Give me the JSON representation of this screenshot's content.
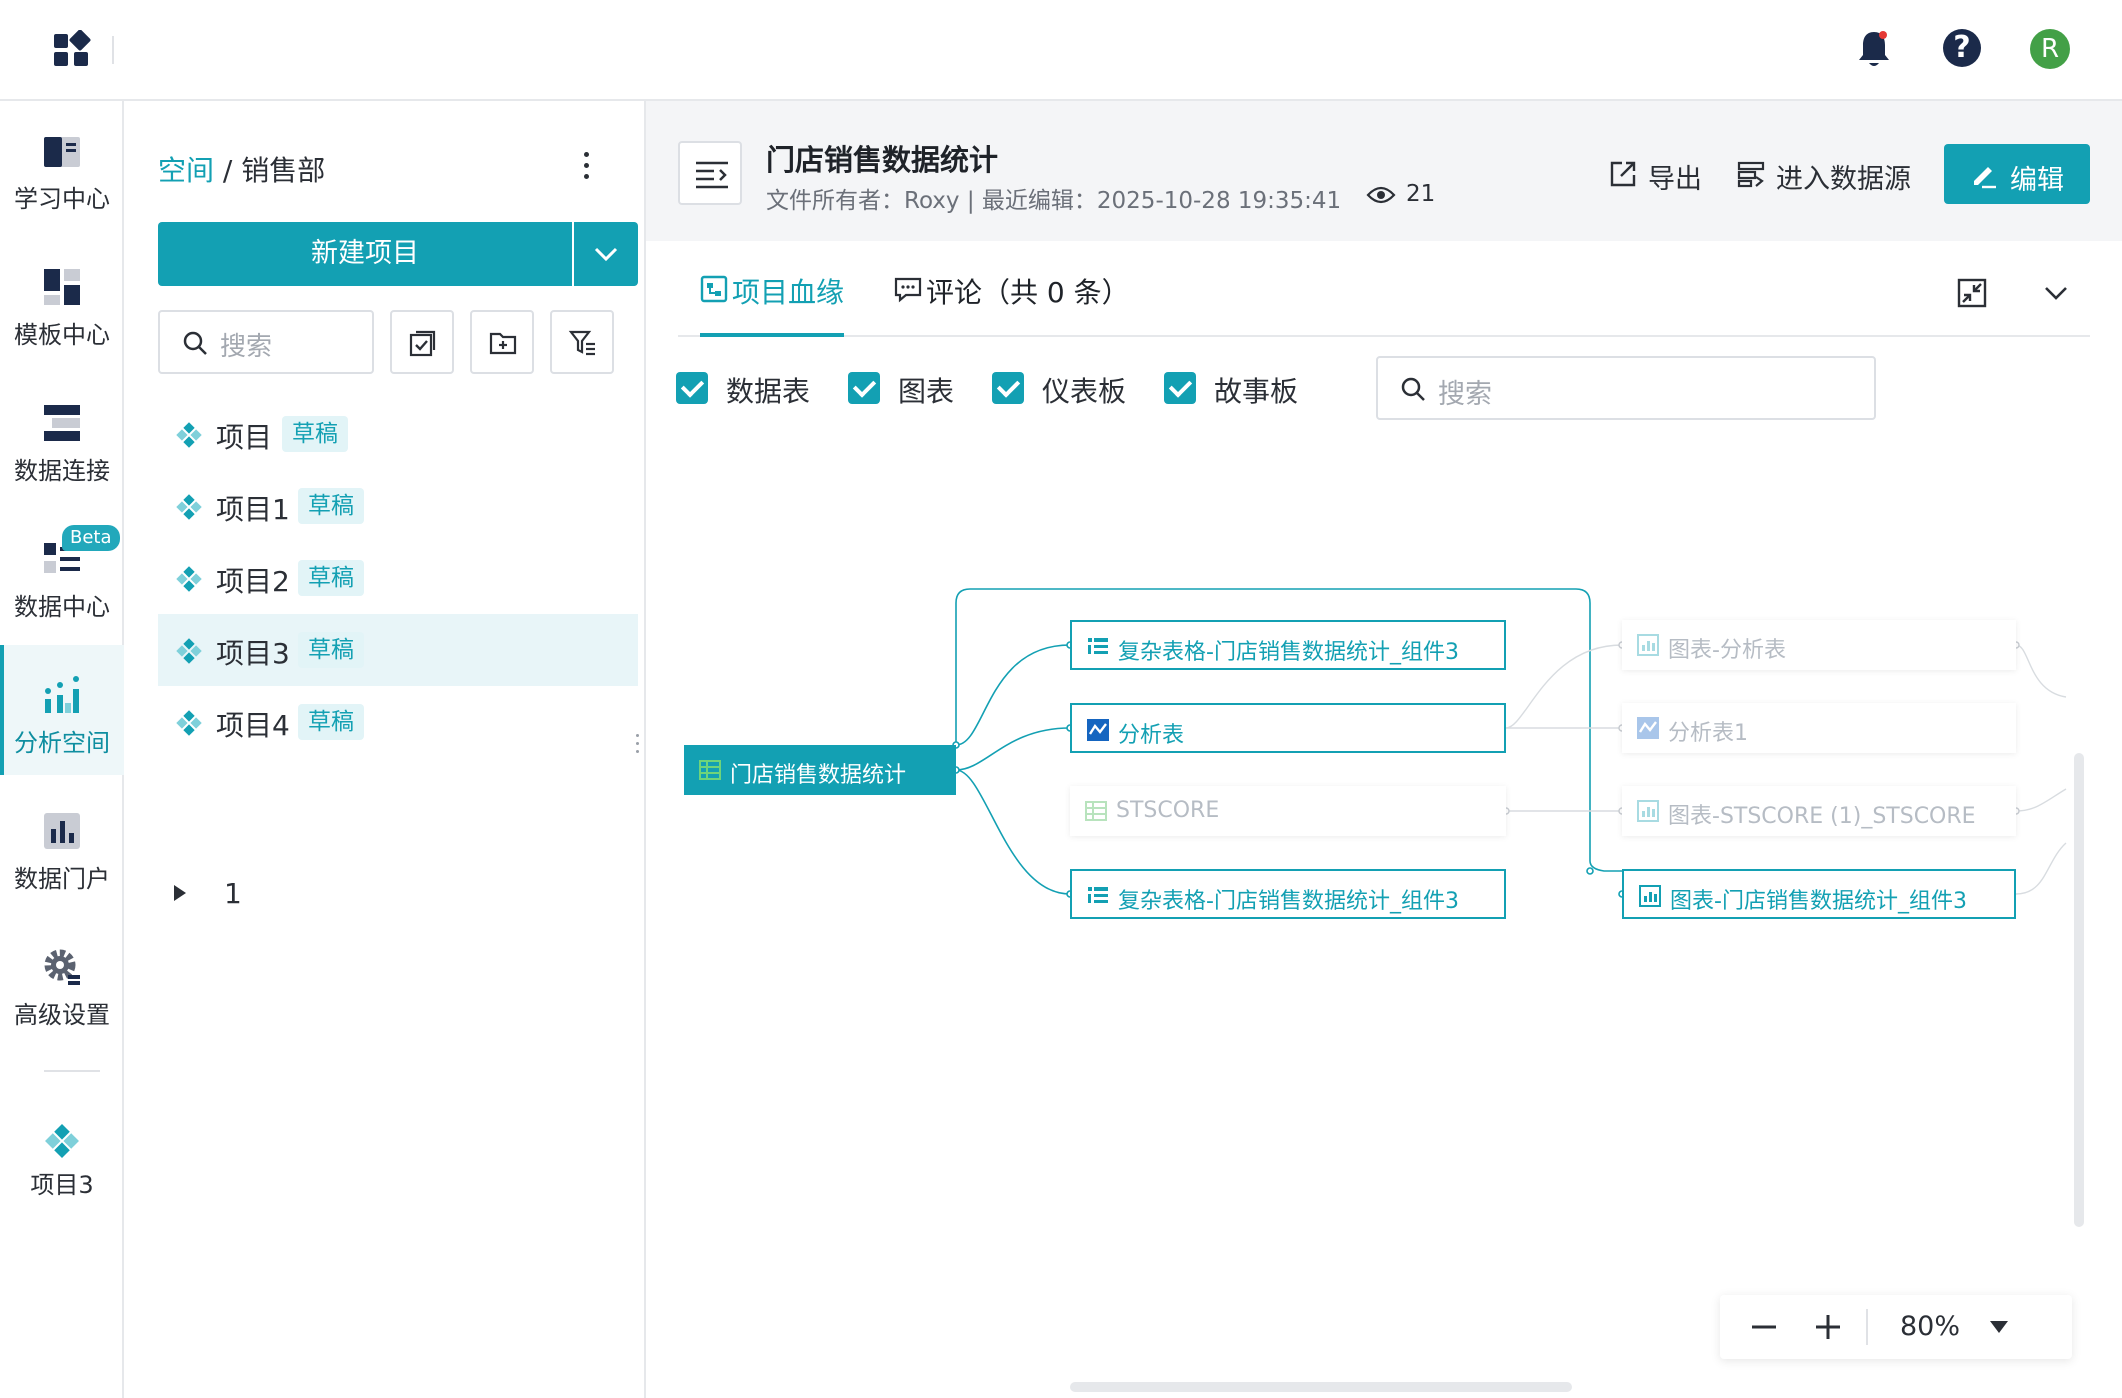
{
  "nav": {
    "items": [
      {
        "label": "学习中心"
      },
      {
        "label": "模板中心"
      },
      {
        "label": "数据连接"
      },
      {
        "label": "数据中心",
        "badge": "Beta"
      },
      {
        "label": "分析空间",
        "active": true
      },
      {
        "label": "数据门户"
      },
      {
        "label": "高级设置"
      },
      {
        "label": "项目3"
      }
    ]
  },
  "topbar": {
    "avatar_letter": "R"
  },
  "sidebar": {
    "breadcrumb_link": "空间",
    "breadcrumb_sep": " / ",
    "breadcrumb_current": "销售部",
    "new_project_label": "新建项目",
    "search_placeholder": "搜索",
    "projects": [
      {
        "name": "项目",
        "tag": "草稿"
      },
      {
        "name": "项目1",
        "tag": "草稿"
      },
      {
        "name": "项目2",
        "tag": "草稿"
      },
      {
        "name": "项目3",
        "tag": "草稿",
        "selected": true
      },
      {
        "name": "项目4",
        "tag": "草稿"
      }
    ],
    "folder": "1"
  },
  "header": {
    "title": "门店销售数据统计",
    "meta": "文件所有者：Roxy | 最近编辑：2025-10-28 19:35:41",
    "views": "21",
    "export_label": "导出",
    "datasource_label": "进入数据源",
    "edit_label": "编辑"
  },
  "tabs": [
    {
      "label": "项目血缘",
      "active": true
    },
    {
      "label": "评论（共 0 条）"
    }
  ],
  "filters": {
    "options": [
      {
        "label": "数据表",
        "checked": true
      },
      {
        "label": "图表",
        "checked": true
      },
      {
        "label": "仪表板",
        "checked": true
      },
      {
        "label": "故事板",
        "checked": true
      }
    ],
    "search_placeholder": "搜索"
  },
  "lineage": {
    "source": "门店销售数据统计",
    "level1": [
      {
        "label": "复杂表格-门店销售数据统计_组件3",
        "state": "active",
        "icon": "complex-table-icon"
      },
      {
        "label": "分析表",
        "state": "active",
        "icon": "analysis-icon"
      },
      {
        "label": "STSCORE",
        "state": "dim",
        "icon": "table-icon"
      },
      {
        "label": "复杂表格-门店销售数据统计_组件3",
        "state": "active",
        "icon": "complex-table-icon"
      }
    ],
    "level2": [
      {
        "label": "图表-分析表",
        "state": "dim",
        "icon": "chart-icon"
      },
      {
        "label": "分析表1",
        "state": "dim",
        "icon": "analysis-icon"
      },
      {
        "label": "图表-STSCORE (1)_STSCORE",
        "state": "dim",
        "icon": "chart-icon"
      },
      {
        "label": "图表-门店销售数据统计_组件3",
        "state": "active",
        "icon": "chart-icon"
      }
    ]
  },
  "zoom": {
    "value": "80%"
  },
  "colors": {
    "accent": "#13a0b3",
    "nav_dark": "#1b2a4a"
  }
}
